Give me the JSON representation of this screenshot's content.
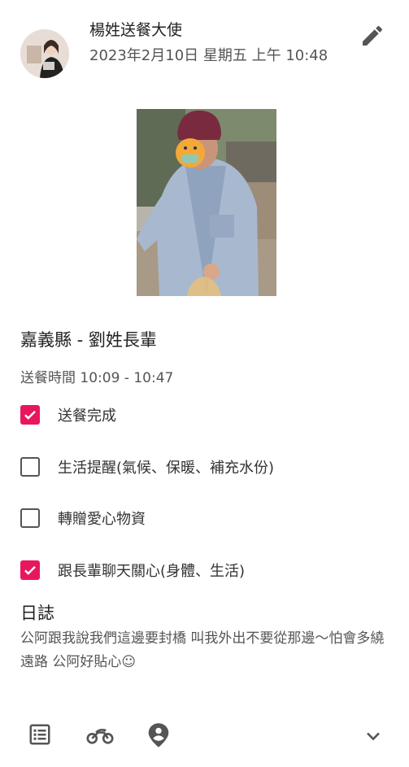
{
  "header": {
    "author": "楊姓送餐大使",
    "date_line": "2023年2月10日 星期五 上午 10:48"
  },
  "post": {
    "title": "嘉義縣 - 劉姓長輩",
    "delivery_time": "送餐時間 10:09 - 10:47"
  },
  "checklist": [
    {
      "label": "送餐完成",
      "checked": true
    },
    {
      "label": "生活提醒(氣候、保暖、補充水份)",
      "checked": false
    },
    {
      "label": "轉贈愛心物資",
      "checked": false
    },
    {
      "label": "跟長輩聊天關心(身體、生活)",
      "checked": true
    }
  ],
  "log": {
    "title": "日誌",
    "text": "公阿跟我說我們這邊要封橋 叫我外出不要從那邊～怕會多繞遠路 公阿好貼心☺"
  },
  "colors": {
    "accent": "#e8175d",
    "text": "#222222",
    "muted": "#555555"
  },
  "icons": {
    "edit": "pencil-icon",
    "bottom": [
      "list-icon",
      "motorcycle-icon",
      "location-person-icon",
      "chevron-down-icon"
    ]
  }
}
